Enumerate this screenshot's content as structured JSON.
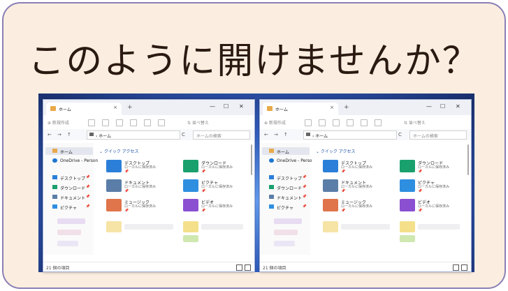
{
  "title": "このように開けませんか？",
  "windows": [
    {
      "tab_label": "ホーム",
      "tab_close": "×",
      "tab_add": "+",
      "minimize": "—",
      "maximize": "☐",
      "close": "✕",
      "new_button": "⊕ 新規作成",
      "sort_button": "⇅ 並べ替え",
      "nav_back": "←",
      "nav_forward": "→",
      "nav_up": "↑",
      "address": "› ホーム",
      "refresh": "C",
      "search_placeholder": "ホームの検索",
      "sidebar": [
        {
          "label": "ホーム",
          "pin": ""
        },
        {
          "label": "OneDrive - Person",
          "pin": ""
        },
        {
          "label": "デスクトップ",
          "pin": "📌"
        },
        {
          "label": "ダウンロード",
          "pin": "📌"
        },
        {
          "label": "ドキュメント",
          "pin": "📌"
        },
        {
          "label": "ピクチャ",
          "pin": "📌"
        }
      ],
      "quick_access": "⌄ クイック アクセス",
      "items": [
        {
          "name": "デスクトップ",
          "sub": "ローカルに保存済み",
          "pin": "📌"
        },
        {
          "name": "ダウンロード",
          "sub": "ローカルに保存済み",
          "pin": "📌"
        },
        {
          "name": "ドキュメント",
          "sub": "ローカルに保存済み",
          "pin": "📌"
        },
        {
          "name": "ピクチャ",
          "sub": "ローカルに保存済み",
          "pin": "📌"
        },
        {
          "name": "ミュージック",
          "sub": "ローカルに保存済み",
          "pin": "📌"
        },
        {
          "name": "ビデオ",
          "sub": "ローカルに保存済み",
          "pin": "📌"
        }
      ],
      "status": "21 個の項目"
    },
    {
      "tab_label": "ホーム",
      "tab_close": "×",
      "tab_add": "+",
      "minimize": "—",
      "maximize": "☐",
      "close": "✕",
      "new_button": "⊕ 新規作成",
      "sort_button": "⇅ 並べ替え",
      "nav_back": "←",
      "nav_forward": "→",
      "nav_up": "↑",
      "address": "› ホーム",
      "refresh": "C",
      "search_placeholder": "ホームの検索",
      "sidebar": [
        {
          "label": "ホーム",
          "pin": ""
        },
        {
          "label": "OneDrive - Perso",
          "pin": ""
        },
        {
          "label": "デスクトップ",
          "pin": "📌"
        },
        {
          "label": "ダウンロード",
          "pin": "📌"
        },
        {
          "label": "ドキュメント",
          "pin": "📌"
        },
        {
          "label": "ピクチャ",
          "pin": "📌"
        }
      ],
      "quick_access": "⌄ クイック アクセス",
      "items": [
        {
          "name": "デスクトップ",
          "sub": "ローカルに保存済み",
          "pin": "📌"
        },
        {
          "name": "ダウンロード",
          "sub": "ローカルに保存済み",
          "pin": "📌"
        },
        {
          "name": "ドキュメント",
          "sub": "ローカルに保存済み",
          "pin": "📌"
        },
        {
          "name": "ピクチャ",
          "sub": "ローカルに保存済み",
          "pin": "📌"
        },
        {
          "name": "ミュージック",
          "sub": "ローカルに保存済み",
          "pin": "📌"
        },
        {
          "name": "ビデオ",
          "sub": "ローカルに保存済み",
          "pin": "📌"
        }
      ],
      "status": "21 個の項目"
    }
  ],
  "colors": {
    "card_bg": "#fbeee0",
    "card_border": "#8a7fb5",
    "title_text": "#2b1a12",
    "desktop_blue": "#3563c9",
    "accent_link": "#1a4fa8",
    "desktop_folder": "#2b7fd9",
    "downloads_folder": "#1aa06d",
    "documents_folder": "#5b7ea8",
    "pictures_folder": "#2e8fe0",
    "music_folder": "#e0744a",
    "videos_folder": "#8b4fd1"
  },
  "icons": [
    "home-icon",
    "onedrive-cloud-icon",
    "desktop-icon",
    "download-icon",
    "documents-icon",
    "pictures-icon",
    "music-icon",
    "videos-icon",
    "pin-icon",
    "search-icon"
  ]
}
